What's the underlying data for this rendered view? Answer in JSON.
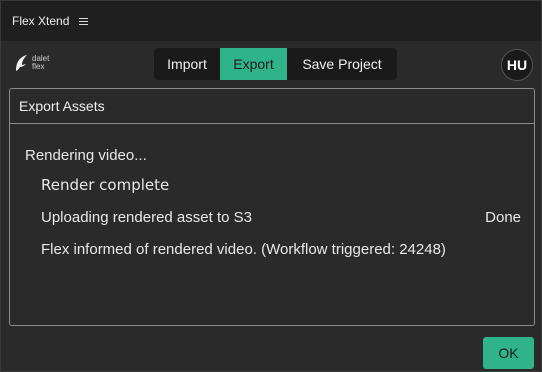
{
  "window": {
    "title": "Flex Xtend"
  },
  "logo": {
    "line1": "dalet",
    "line2": "flex"
  },
  "tabs": [
    {
      "label": "Import"
    },
    {
      "label": "Export",
      "active": true
    },
    {
      "label": "Save Project"
    }
  ],
  "user": {
    "initials": "HU"
  },
  "panel": {
    "title": "Export Assets",
    "status": "Rendering video...",
    "steps": [
      {
        "text": "Render complete",
        "result": ""
      },
      {
        "text": "Uploading rendered asset to S3",
        "result": "Done"
      },
      {
        "text": "Flex informed of rendered video. (Workflow triggered: 24248)",
        "result": ""
      }
    ]
  },
  "footer": {
    "ok_label": "OK"
  },
  "colors": {
    "accent": "#2fb48a",
    "background": "#2a2a2a",
    "titlebar": "#1f1f1f"
  }
}
